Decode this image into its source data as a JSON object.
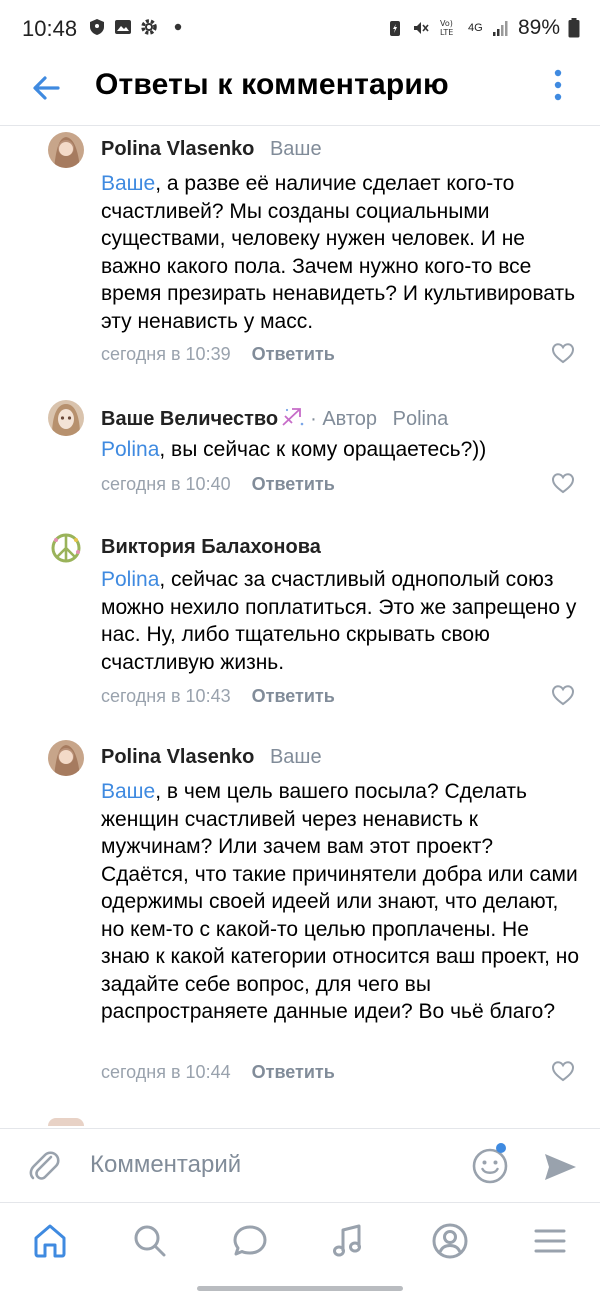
{
  "status_bar": {
    "time": "10:48",
    "network": "4G",
    "battery": "89%",
    "icons": [
      "shield-icon",
      "gallery-icon",
      "settings-gear-icon",
      "dot-icon",
      "battery-saver-icon",
      "mute-icon",
      "volte-icon",
      "signal-icon",
      "battery-icon"
    ]
  },
  "header": {
    "title": "Ответы к комментарию",
    "back_icon": "arrow-left-icon",
    "menu_icon": "more-vertical-icon"
  },
  "comments": [
    {
      "author": "Polina Vlasenko",
      "meta": "",
      "reply_to": "Ваше",
      "mention": "Ваше",
      "text": ", а разве её наличие сделает кого-то счастливей? Мы созданы социальными существами, человеку нужен человек. И не важно какого пола. Зачем нужно кого-то все время презирать ненавидеть? И культивировать эту ненависть у масс.",
      "time": "сегодня в 10:39",
      "reply_label": "Ответить"
    },
    {
      "author": "Ваше Величество",
      "meta": "· Автор",
      "reply_to": "Polina",
      "mention": "Polina",
      "text": ", вы сейчас к кому оращаетесь?))",
      "time": "сегодня в 10:40",
      "reply_label": "Ответить"
    },
    {
      "author": "Виктория Балахонова",
      "meta": "",
      "reply_to": "",
      "mention": "Polina",
      "text": ", сейчас за счастливый однополый союз можно нехило поплатиться. Это же запрещено у нас. Ну, либо тщательно скрывать свою счастливую жизнь.",
      "time": "сегодня в 10:43",
      "reply_label": "Ответить"
    },
    {
      "author": "Polina Vlasenko",
      "meta": "",
      "reply_to": "Ваше",
      "mention": "Ваше",
      "text": ", в чем цель вашего посыла? Сделать женщин счастливей через ненависть к мужчинам? Или зачем вам этот проект? Сдаётся, что такие причинятели добра или сами одержимы своей идеей или знают, что делают, но кем-то с какой-то целью проплачены. Не знаю к какой категории относится ваш проект, но задайте себе вопрос, для чего вы распространяете данные идеи? Во чьё благо?",
      "time": "сегодня в 10:44",
      "reply_label": "Ответить"
    }
  ],
  "composer": {
    "placeholder": "Комментарий"
  },
  "colors": {
    "accent": "#3f8ae0",
    "secondary_text": "#818c99"
  }
}
